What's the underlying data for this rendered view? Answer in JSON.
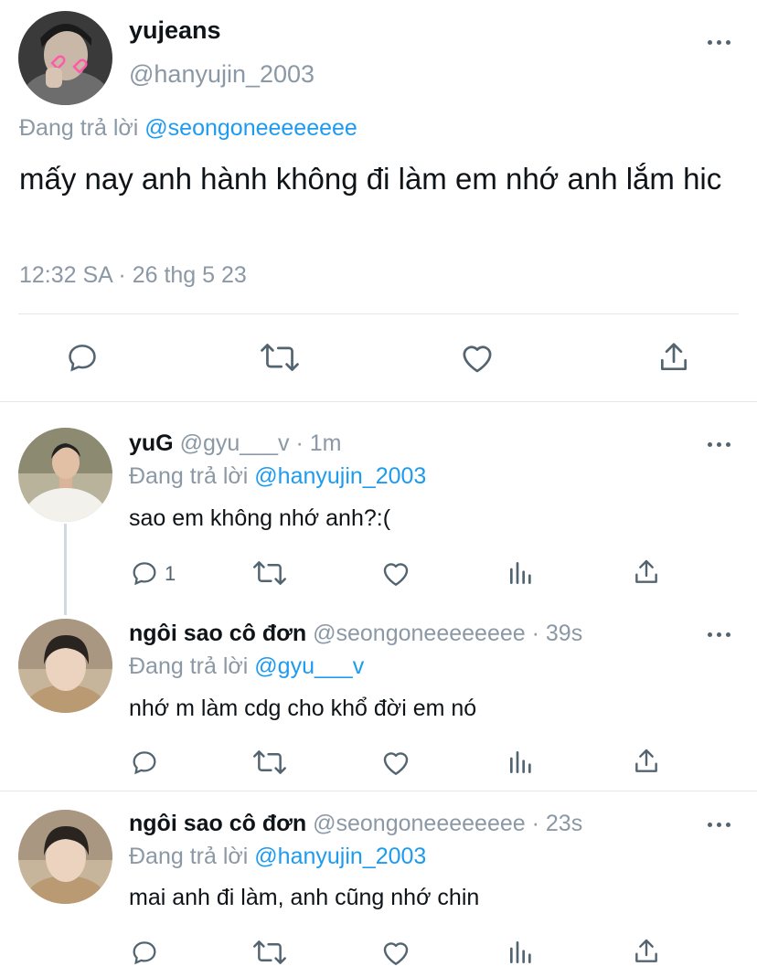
{
  "main_tweet": {
    "name": "yujeans",
    "handle": "@hanyujin_2003",
    "replying_prefix": "Đang trả lời",
    "replying_to": "@seongoneeeeeeee",
    "text": "mấy nay anh hành không đi làm em nhớ anh lắm hic",
    "timestamp": "12:32 SA · 26 thg 5 23",
    "actions": [
      "reply-icon",
      "retweet-icon",
      "like-icon",
      "share-icon"
    ]
  },
  "replies": [
    {
      "name": "yuG",
      "handle": "@gyu___v",
      "time": "· 1m",
      "replying_prefix": "Đang trả lời",
      "replying_to": "@hanyujin_2003",
      "text": "sao em không nhớ anh?:(",
      "reply_count": "1"
    },
    {
      "name": "ngôi sao cô đơn",
      "handle": "@seongoneeeeeeee",
      "time": "· 39s",
      "replying_prefix": "Đang trả lời",
      "replying_to": "@gyu___v",
      "text": "nhớ m làm cdg cho khổ đời em nó",
      "reply_count": ""
    },
    {
      "name": "ngôi sao cô đơn",
      "handle": "@seongoneeeeeeee",
      "time": "· 23s",
      "replying_prefix": "Đang trả lời",
      "replying_to": "@hanyujin_2003",
      "text": "mai anh đi làm, anh cũng nhớ chin",
      "reply_count": ""
    }
  ],
  "colors": {
    "link": "#1d9bf0",
    "secondary_text": "#8b98a5",
    "icon": "#536471",
    "divider": "#e1e8ed"
  }
}
